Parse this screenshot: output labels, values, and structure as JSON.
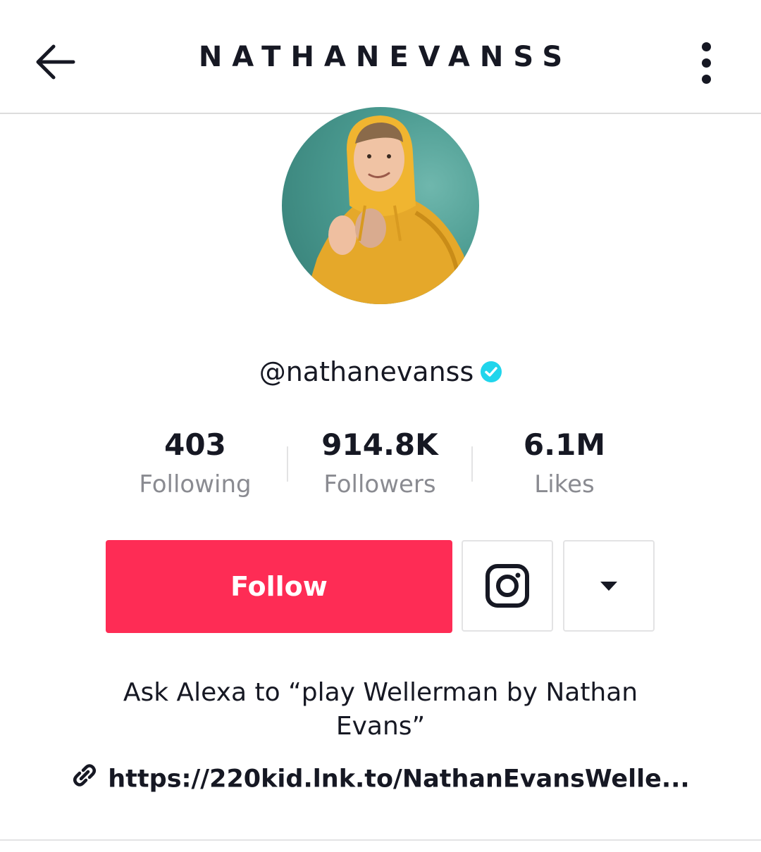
{
  "header": {
    "title": "NATHANEVANSS",
    "back_icon": "arrow-left-icon",
    "more_icon": "vertical-dots-icon"
  },
  "profile": {
    "username": "@nathanevanss",
    "verified": true,
    "verified_color": "#20d5ec"
  },
  "stats": {
    "following": {
      "value": "403",
      "label": "Following"
    },
    "followers": {
      "value": "914.8K",
      "label": "Followers"
    },
    "likes": {
      "value": "6.1M",
      "label": "Likes"
    }
  },
  "actions": {
    "follow_label": "Follow",
    "follow_color": "#fe2c55",
    "instagram_icon": "instagram-icon",
    "more_options_icon": "caret-down-icon"
  },
  "bio": {
    "text": "Ask Alexa to “play Wellerman by Nathan Evans”",
    "link": "https://220kid.lnk.to/NathanEvansWelle...",
    "link_icon": "link-icon"
  }
}
